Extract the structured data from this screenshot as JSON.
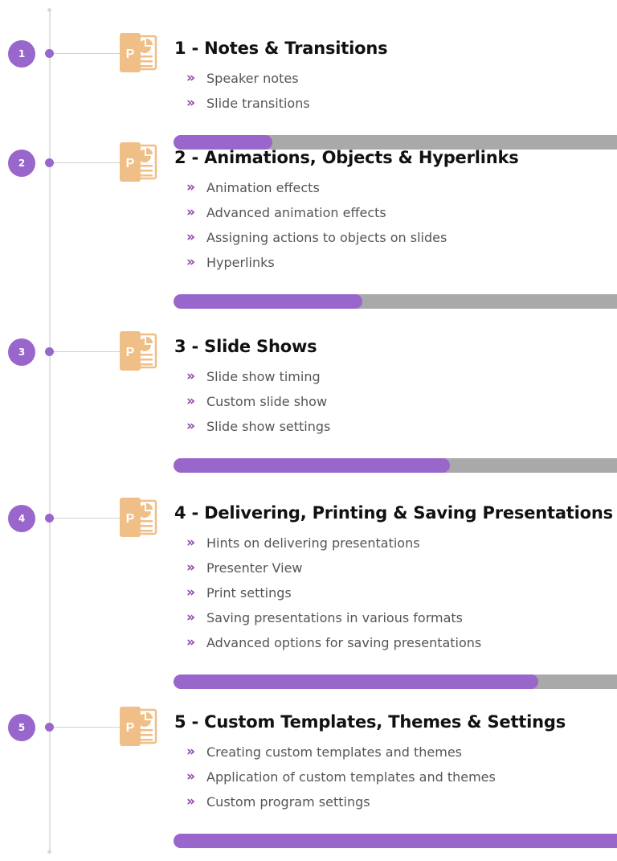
{
  "colors": {
    "accent": "#9966cc",
    "chevron": "#8e44ad",
    "progress_track": "#a9a9a9",
    "icon": "#f0be87",
    "timeline": "#e2e2e2"
  },
  "icon_name": "powerpoint-icon",
  "icon_letter": "P",
  "bullet_glyph": "»",
  "modules": [
    {
      "number": "1",
      "title": "1 - Notes & Transitions",
      "items": [
        "Speaker notes",
        "Slide transitions"
      ],
      "progress": 0.22
    },
    {
      "number": "2",
      "title": "2 - Animations, Objects & Hyperlinks",
      "items": [
        "Animation effects",
        "Advanced animation effects",
        "Assigning actions to objects on slides",
        "Hyperlinks"
      ],
      "progress": 0.42
    },
    {
      "number": "3",
      "title": "3 - Slide Shows",
      "items": [
        "Slide show timing",
        "Custom slide show",
        "Slide show settings"
      ],
      "progress": 0.615
    },
    {
      "number": "4",
      "title": "4 - Delivering, Printing & Saving Presentations",
      "items": [
        "Hints on delivering presentations",
        "Presenter View",
        "Print settings",
        "Saving presentations in various formats",
        "Advanced options for saving presentations"
      ],
      "progress": 0.81
    },
    {
      "number": "5",
      "title": "5 - Custom Templates, Themes & Settings",
      "items": [
        "Creating custom templates and themes",
        "Application of custom templates and themes",
        "Custom program settings"
      ],
      "progress": 1.0
    }
  ]
}
